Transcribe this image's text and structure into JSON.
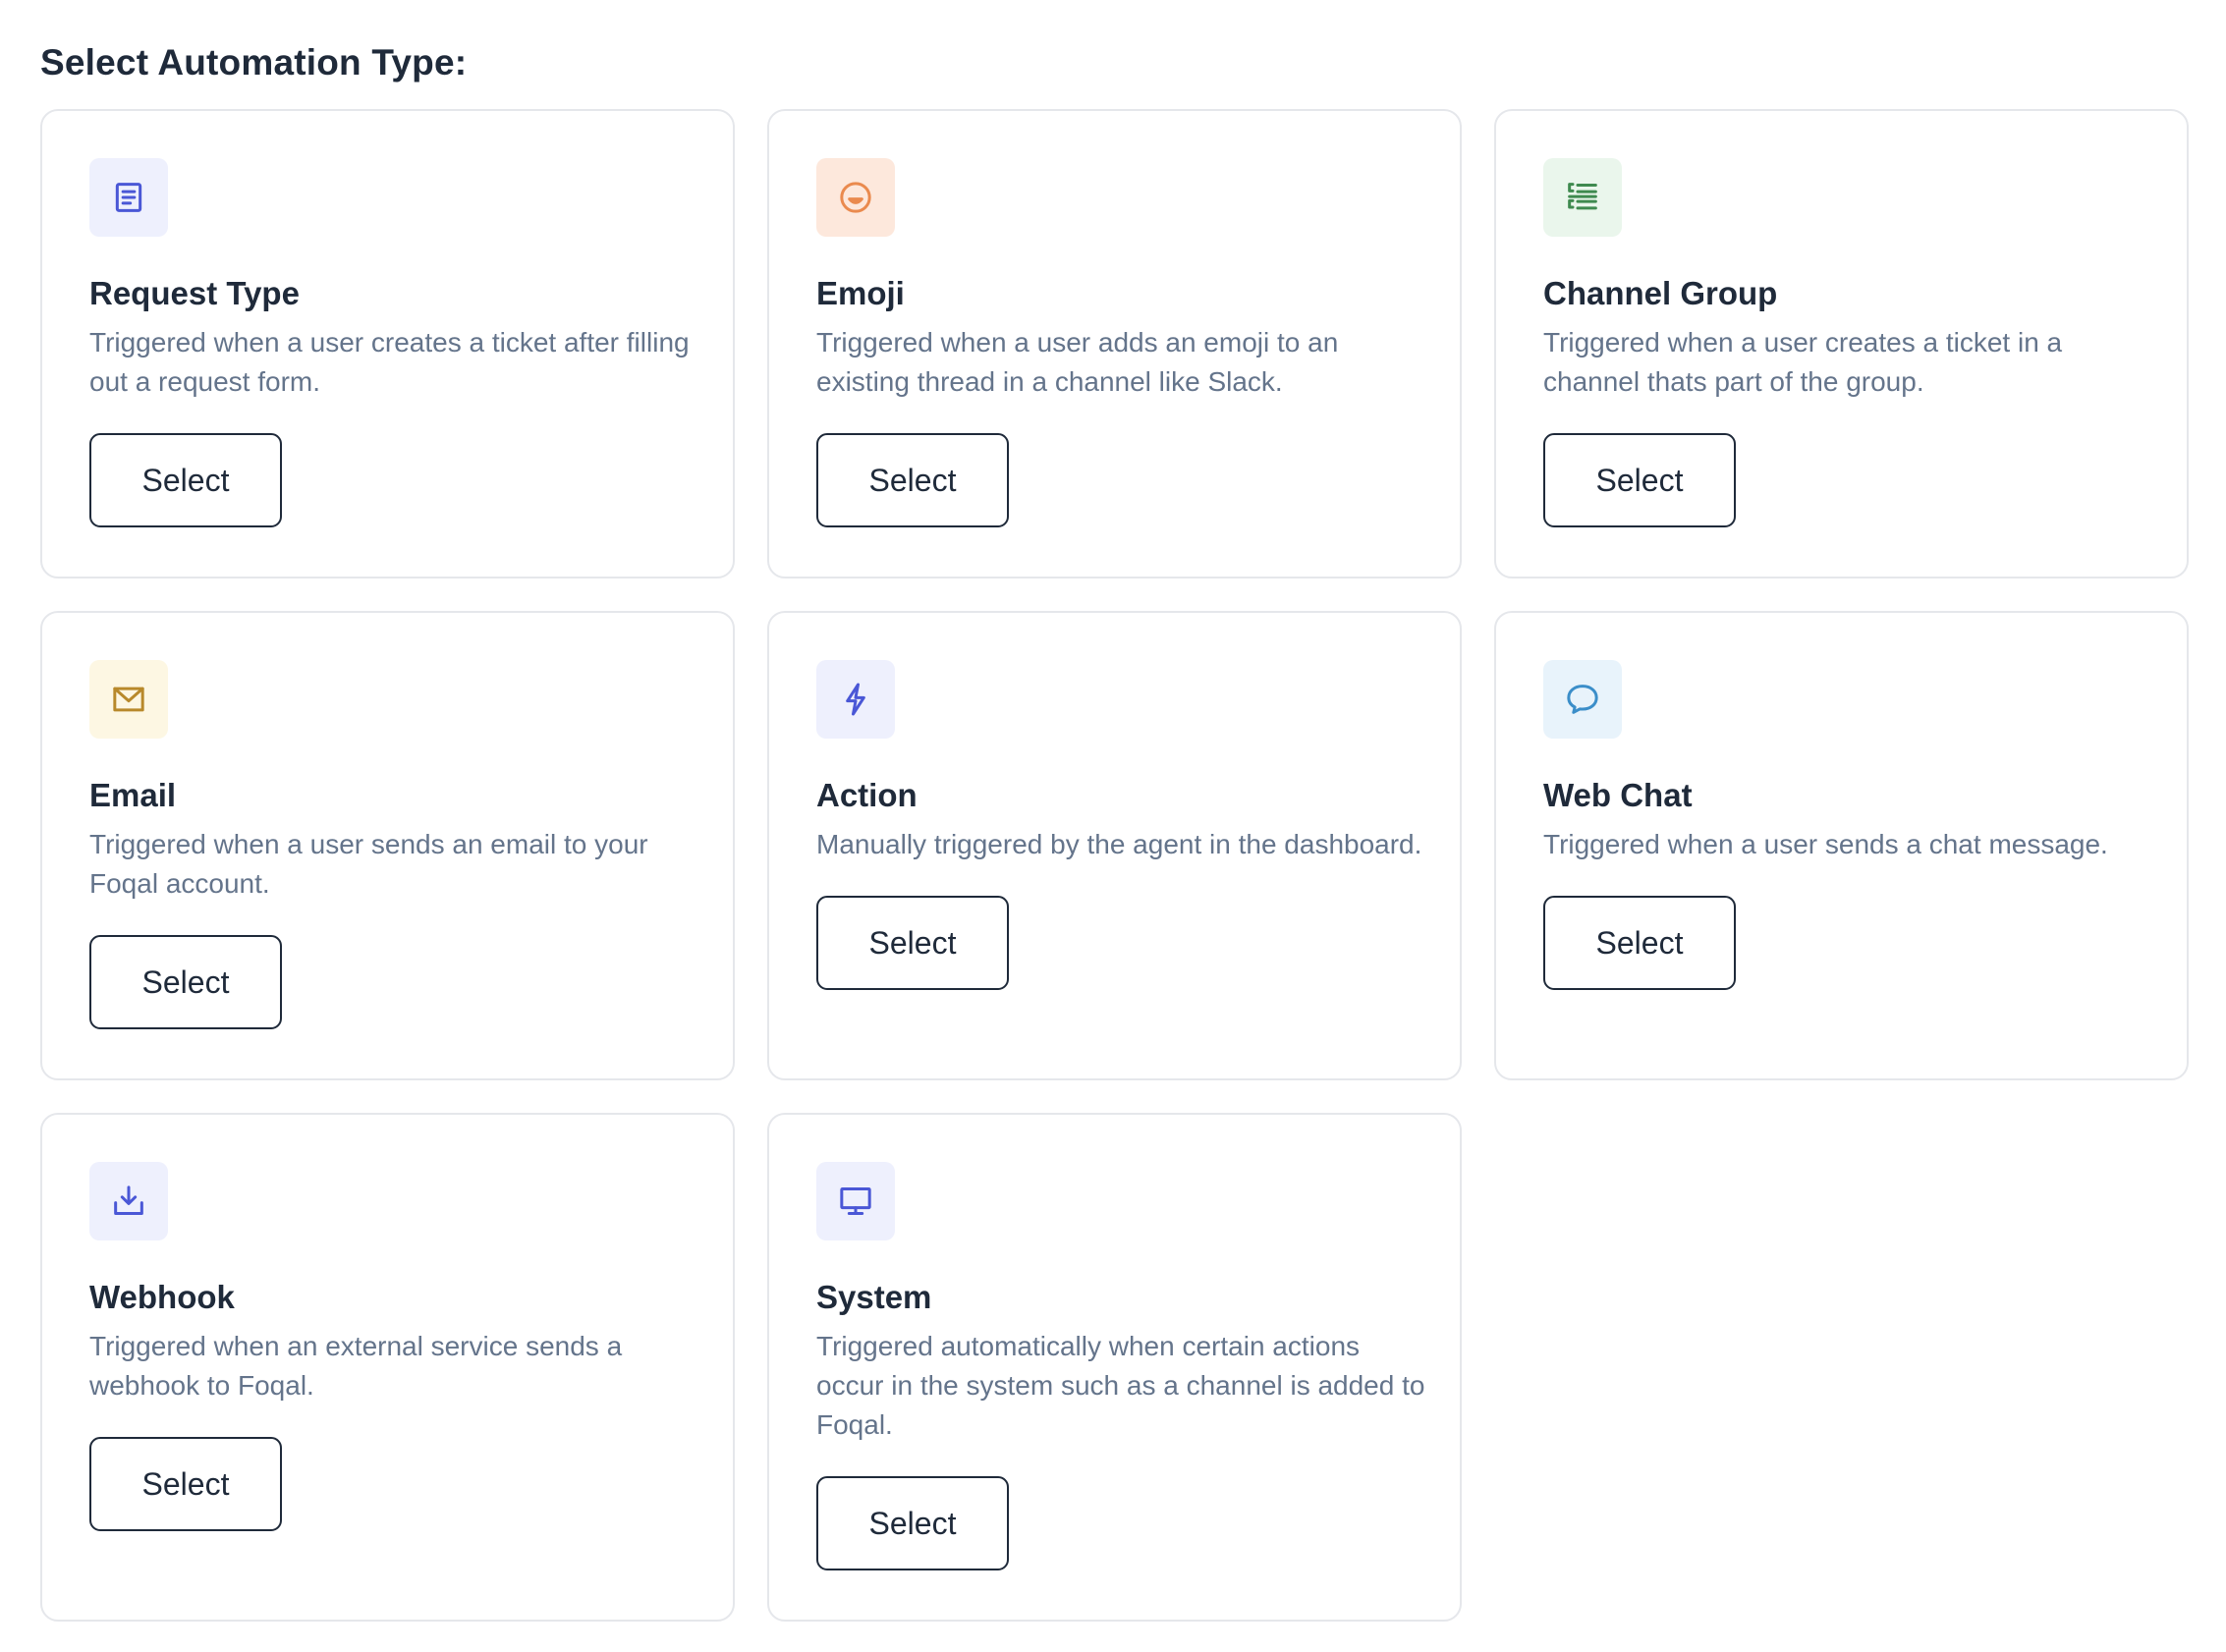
{
  "heading": "Select Automation Type:",
  "cards": [
    {
      "title": "Request Type",
      "description": "Triggered when a user creates a ticket after filling out a request form.",
      "button": "Select",
      "icon": "document-icon",
      "icon_color": "#4a57d6",
      "icon_bg": "#eef0fd"
    },
    {
      "title": "Emoji",
      "description": "Triggered when a user adds an emoji to an existing thread in a channel like Slack.",
      "button": "Select",
      "icon": "emoji-icon",
      "icon_color": "#ea8a4e",
      "icon_bg": "#fde8dc"
    },
    {
      "title": "Channel Group",
      "description": "Triggered when a user creates a ticket in a channel thats part of the group.",
      "button": "Select",
      "icon": "list-icon",
      "icon_color": "#3f8a4f",
      "icon_bg": "#eaf6ec"
    },
    {
      "title": "Email",
      "description": "Triggered when a user sends an email to your Foqal account.",
      "button": "Select",
      "icon": "envelope-icon",
      "icon_color": "#b8892b",
      "icon_bg": "#fdf7e3"
    },
    {
      "title": "Action",
      "description": "Manually triggered by the agent in the dashboard.",
      "button": "Select",
      "icon": "lightning-icon",
      "icon_color": "#4a57d6",
      "icon_bg": "#eef0fd"
    },
    {
      "title": "Web Chat",
      "description": "Triggered when a user sends a chat message.",
      "button": "Select",
      "icon": "chat-bubble-icon",
      "icon_color": "#3b8ec9",
      "icon_bg": "#e8f3fb"
    },
    {
      "title": "Webhook",
      "description": "Triggered when an external service sends a webhook to Foqal.",
      "button": "Select",
      "icon": "download-tray-icon",
      "icon_color": "#4a57d6",
      "icon_bg": "#eef0fd"
    },
    {
      "title": "System",
      "description": "Triggered automatically when certain actions occur in the system such as a channel is added to Foqal.",
      "button": "Select",
      "icon": "monitor-icon",
      "icon_color": "#4a57d6",
      "icon_bg": "#eef0fd"
    }
  ]
}
